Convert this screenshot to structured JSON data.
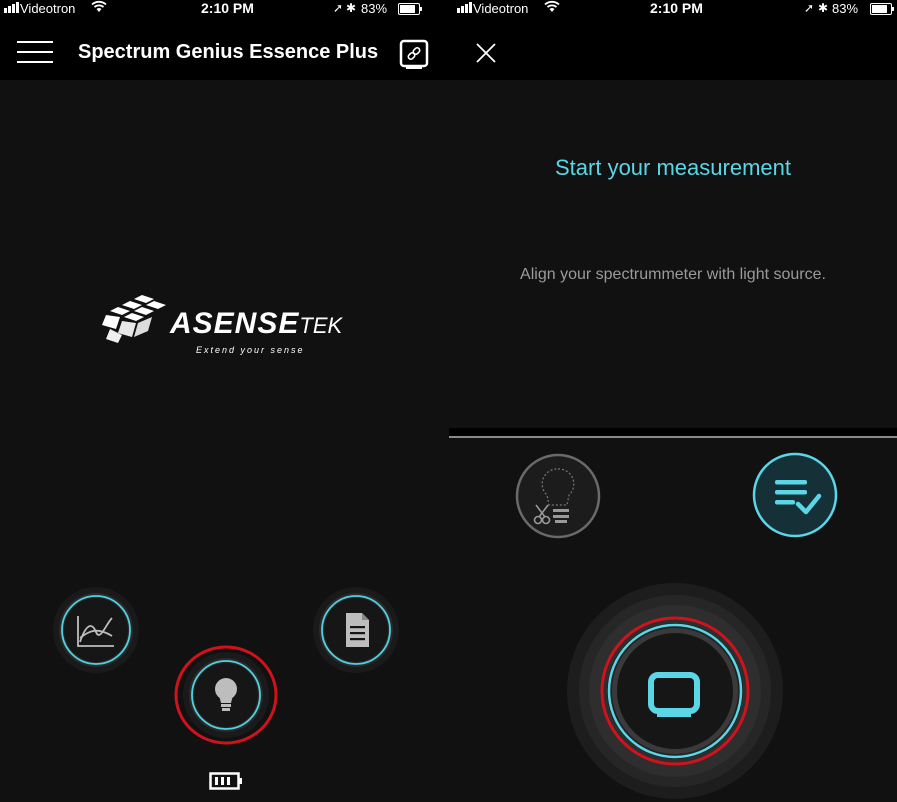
{
  "left": {
    "status": {
      "carrier": "Videotron",
      "time": "2:10 PM",
      "battery": "83%"
    },
    "nav": {
      "title": "Spectrum Genius Essence Plus"
    },
    "logo": {
      "brand": "ASENSE",
      "brand_suffix": "TEK",
      "tagline": "Extend your sense"
    },
    "buttons": {
      "chart": {
        "icon": "line-chart-icon"
      },
      "report": {
        "icon": "document-icon"
      },
      "light": {
        "icon": "light-bulb-icon"
      }
    },
    "battery_icon": "device-battery-icon"
  },
  "right": {
    "status": {
      "carrier": "Videotron",
      "time": "2:10 PM",
      "battery": "83%"
    },
    "title": "Start your measurement",
    "instruction": "Align your spectrummeter with light source.",
    "buttons": {
      "bulb_cut": {
        "icon": "bulb-scissors-icon"
      },
      "checklist": {
        "icon": "checklist-icon"
      },
      "measure": {
        "icon": "device-measure-icon"
      }
    }
  },
  "colors": {
    "accent": "#5ad6e6",
    "highlight_ring": "#d0121c",
    "background": "#111111"
  }
}
